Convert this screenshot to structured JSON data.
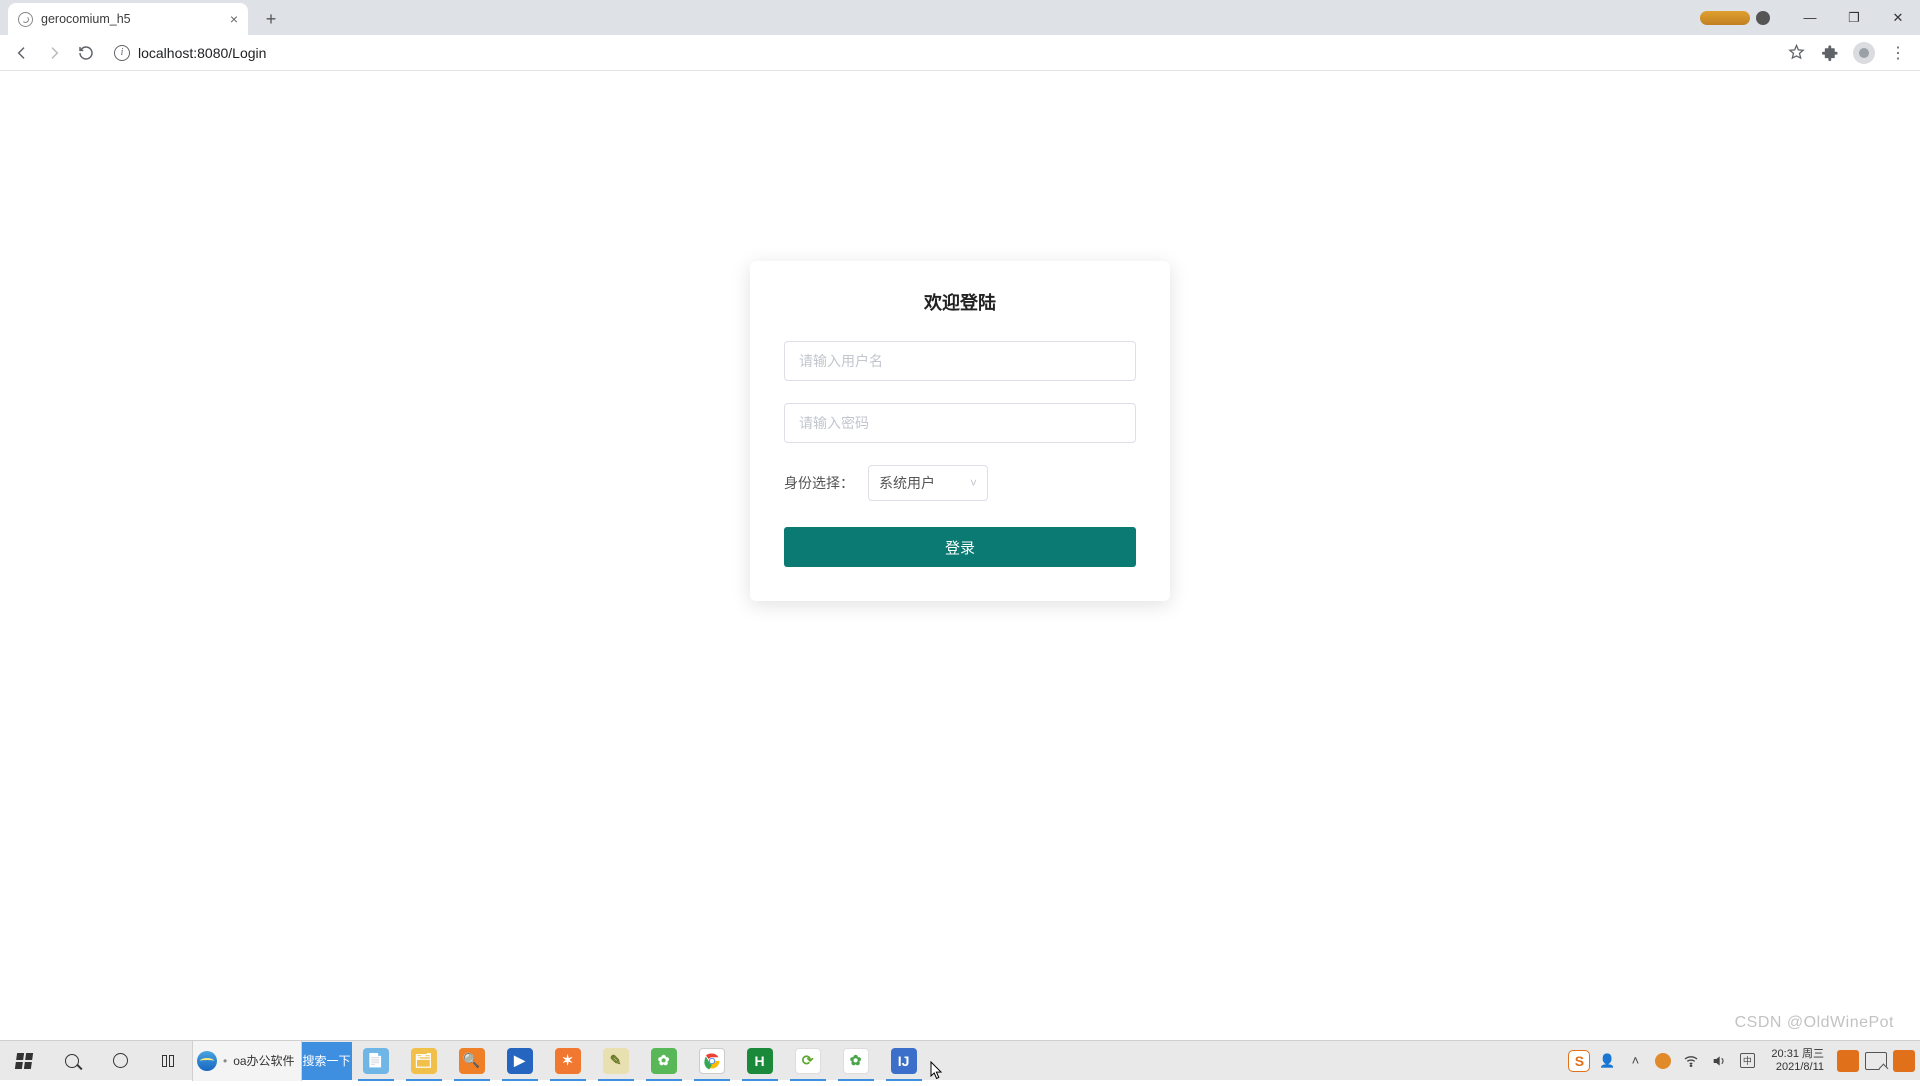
{
  "browser": {
    "tab_title": "gerocomium_h5",
    "url": "localhost:8080/Login"
  },
  "login": {
    "title": "欢迎登陆",
    "username_placeholder": "请输入用户名",
    "password_placeholder": "请输入密码",
    "role_label": "身份选择：",
    "role_value": "系统用户",
    "submit": "登录"
  },
  "taskbar": {
    "ie_text": "oa办公软件",
    "ie_search": "搜索一下",
    "clock_time": "20:31",
    "clock_day": "周三",
    "clock_date": "2021/8/11"
  },
  "watermark": "CSDN @OldWinePot"
}
